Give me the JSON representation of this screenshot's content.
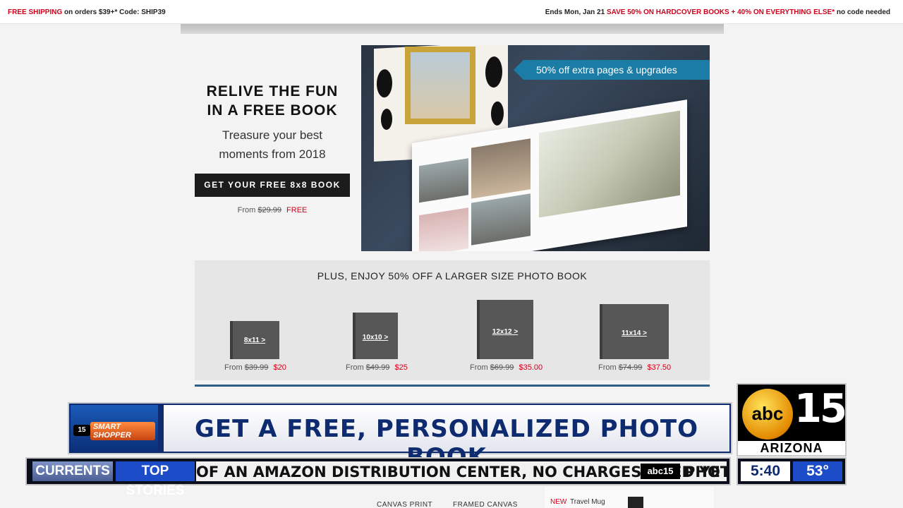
{
  "topbar": {
    "left_highlight": "FREE SHIPPING",
    "left_text": " on orders $39+* Code: SHIP39",
    "right_prefix": "Ends Mon, Jan 21 ",
    "right_highlight": "SAVE 50% ON HARDCOVER BOOKS + 40% ON EVERYTHING ELSE*",
    "right_suffix": " no code needed"
  },
  "promo": {
    "title_line1": "RELIVE THE FUN",
    "title_line2": "IN A FREE BOOK",
    "subtitle_line1": "Treasure your best",
    "subtitle_line2": "moments from 2018",
    "cta_label": "GET YOUR FREE 8x8 BOOK",
    "price_from": "From",
    "price_old": "$29.99",
    "price_new": "FREE"
  },
  "hero": {
    "tag": "50% off extra pages & upgrades"
  },
  "sizes": {
    "heading": "PLUS, ENJOY 50% OFF A LARGER SIZE PHOTO BOOK",
    "items": [
      {
        "label": "8x11 >",
        "from": "From",
        "old": "$39.99",
        "new": "$20"
      },
      {
        "label": "10x10 >",
        "from": "From",
        "old": "$49.99",
        "new": "$25"
      },
      {
        "label": "12x12 >",
        "from": "From",
        "old": "$69.99",
        "new": "$35.00"
      },
      {
        "label": "11x14 >",
        "from": "From",
        "old": "$74.99",
        "new": "$37.50"
      }
    ]
  },
  "bottomnav": {
    "canvas_print": "CANVAS PRINT",
    "framed_canvas": "FRAMED CANVAS",
    "mug_new": "NEW",
    "mug_name": "Travel Mug"
  },
  "broadcast": {
    "segment_logo": "15",
    "segment_name": "SMART SHOPPER",
    "headline": "GET A FREE, PERSONALIZED PHOTO BOOK",
    "station_network": "abc",
    "station_number": "15",
    "station_region": "ARIZONA",
    "ticker_label": "CURRENTS",
    "ticker_section": "TOP STORIES",
    "ticker_text": "OF AN AMAZON DISTRIBUTION CENTER, NO CHARGES FILED YET",
    "ticker_logo": "abc15",
    "ticker_text2": "PHO",
    "time": "5:40",
    "temperature": "53°"
  }
}
